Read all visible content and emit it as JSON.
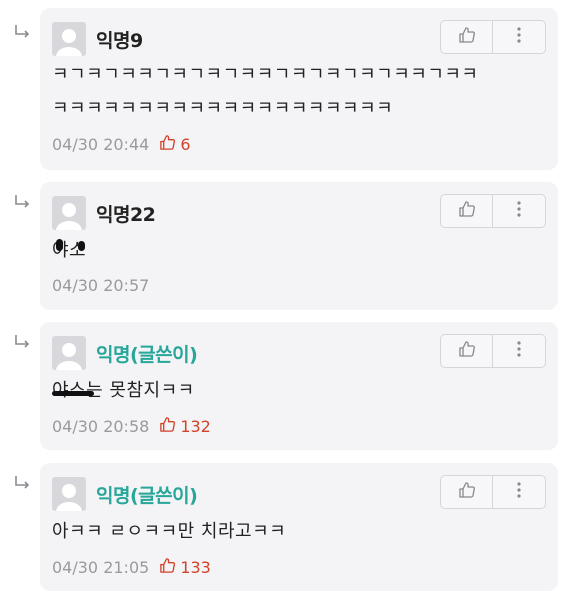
{
  "comments": [
    {
      "author": "익명9",
      "lines": [
        "ㅋㄱㅋㄱㅋㅋㄱㅋㄱㅋㄱㅋㅋㄱㅋㄱㅋㄱㅋㄱㅋㅋㄱㅋㅋ",
        "ㅋㅋㅋㅋㅋㅋㅋㅋㅋㅋㅋㅋㅋㅋㅋㅋㅋㅋㅋㅋ"
      ],
      "timestamp": "04/30 20:44",
      "likes": "6",
      "is_op": false
    },
    {
      "author": "익명22",
      "lines": [
        "야소"
      ],
      "timestamp": "04/30 20:57",
      "likes": "",
      "is_op": false
    },
    {
      "author": "익명(글쓴이)",
      "lines": [
        "야스는 못참지ㅋㅋ"
      ],
      "timestamp": "04/30 20:58",
      "likes": "132",
      "is_op": true
    },
    {
      "author": "익명(글쓴이)",
      "lines": [
        "아ㅋㅋ ㄹㅇㅋㅋ만 치라고ㅋㅋ"
      ],
      "timestamp": "04/30 21:05",
      "likes": "133",
      "is_op": true
    }
  ],
  "icons": {
    "reply": "reply-arrow-icon",
    "avatar": "default-avatar-icon",
    "like": "thumbs-up-icon",
    "more": "more-vertical-icon"
  },
  "colors": {
    "op_author": "#27a69a",
    "likes": "#d2422a",
    "card_bg": "#f4f4f6",
    "meta": "#9a9a9e"
  }
}
